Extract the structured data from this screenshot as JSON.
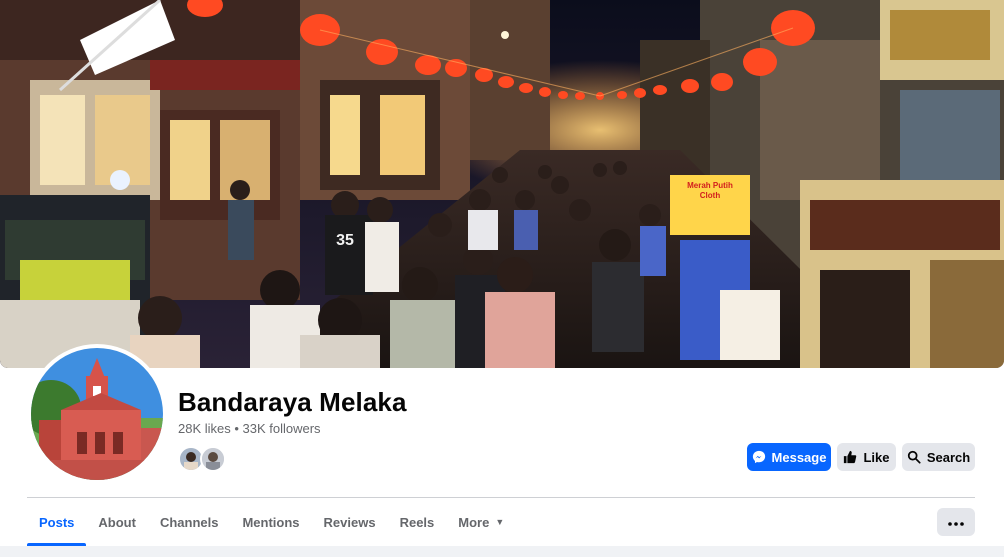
{
  "page": {
    "name": "Bandaraya Melaka",
    "stats": "28K likes • 33K followers"
  },
  "cover": {
    "shop_sign": "Merah Putih\nCloth",
    "jersey_number": "35"
  },
  "actions": {
    "message_label": "Message",
    "like_label": "Like",
    "search_label": "Search"
  },
  "tabs": [
    {
      "label": "Posts",
      "active": true
    },
    {
      "label": "About"
    },
    {
      "label": "Channels"
    },
    {
      "label": "Mentions"
    },
    {
      "label": "Reviews"
    },
    {
      "label": "Reels"
    },
    {
      "label": "More"
    }
  ],
  "icons": {
    "message": "messenger-icon",
    "like": "thumbs-up-icon",
    "search": "search-icon",
    "more": "ellipsis-icon",
    "more_tab": "caret-down-icon"
  },
  "colors": {
    "accent": "#0866ff",
    "secondary_button": "#e4e6eb",
    "text_primary": "#050505",
    "text_secondary": "#65676b"
  }
}
